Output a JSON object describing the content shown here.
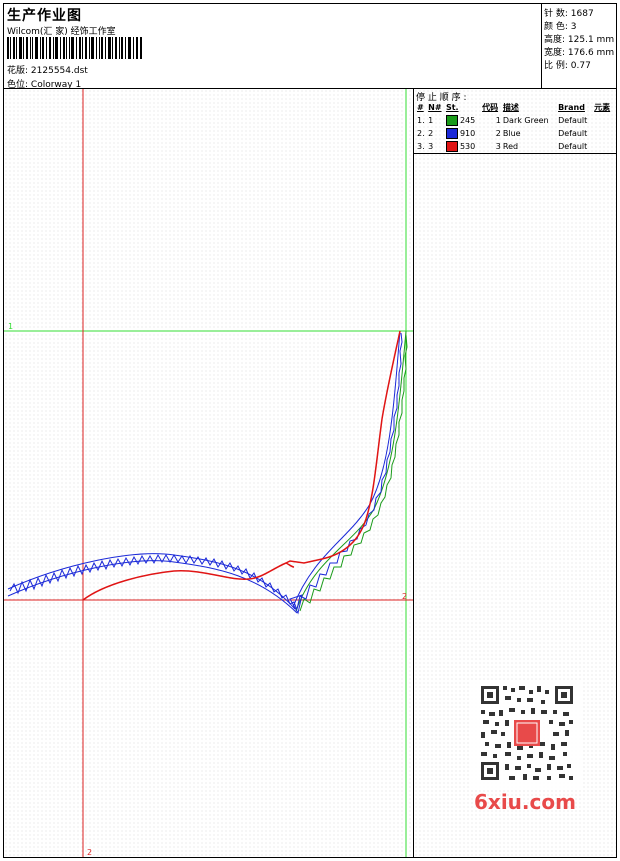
{
  "header": {
    "title": "生产作业图",
    "subtitle": "Wilcom(汇 家) 经饰工作室",
    "design_label": "花版:",
    "design_value": "2125554.dst",
    "colorway_label": "色位:",
    "colorway_value": "Colorway 1"
  },
  "stats": [
    {
      "label": "针 数:",
      "value": "1687"
    },
    {
      "label": "颜 色:",
      "value": "3"
    },
    {
      "label": "高度:",
      "value": "125.1 mm"
    },
    {
      "label": "宽度:",
      "value": "176.6 mm"
    },
    {
      "label": "比 例:",
      "value": "0.77"
    }
  ],
  "stop_sequence": {
    "heading": "停 止 顺 序 :",
    "columns": [
      "#",
      "N#",
      "St.",
      "代码",
      "描述",
      "Brand",
      "元素"
    ],
    "rows": [
      {
        "num": "1.",
        "n": "1",
        "color": "#1a9b1a",
        "st": "245",
        "code": "1",
        "desc": "Dark Green",
        "brand": "Default"
      },
      {
        "num": "2.",
        "n": "2",
        "color": "#1a28d8",
        "st": "910",
        "code": "2",
        "desc": "Blue",
        "brand": "Default"
      },
      {
        "num": "3.",
        "n": "3",
        "color": "#e01414",
        "st": "530",
        "code": "3",
        "desc": "Red",
        "brand": "Default"
      }
    ]
  },
  "guides": {
    "h_green_label": "1",
    "h_red_label": "2",
    "v_red_label": "2"
  },
  "colors": {
    "green_guide": "#33dd33",
    "red_guide": "#dd2222",
    "green_stitch": "#1a9b1a",
    "blue_stitch": "#1a28d8",
    "red_stitch": "#e01414"
  },
  "watermark": "6xiu.com",
  "stamp": "汉风图案"
}
